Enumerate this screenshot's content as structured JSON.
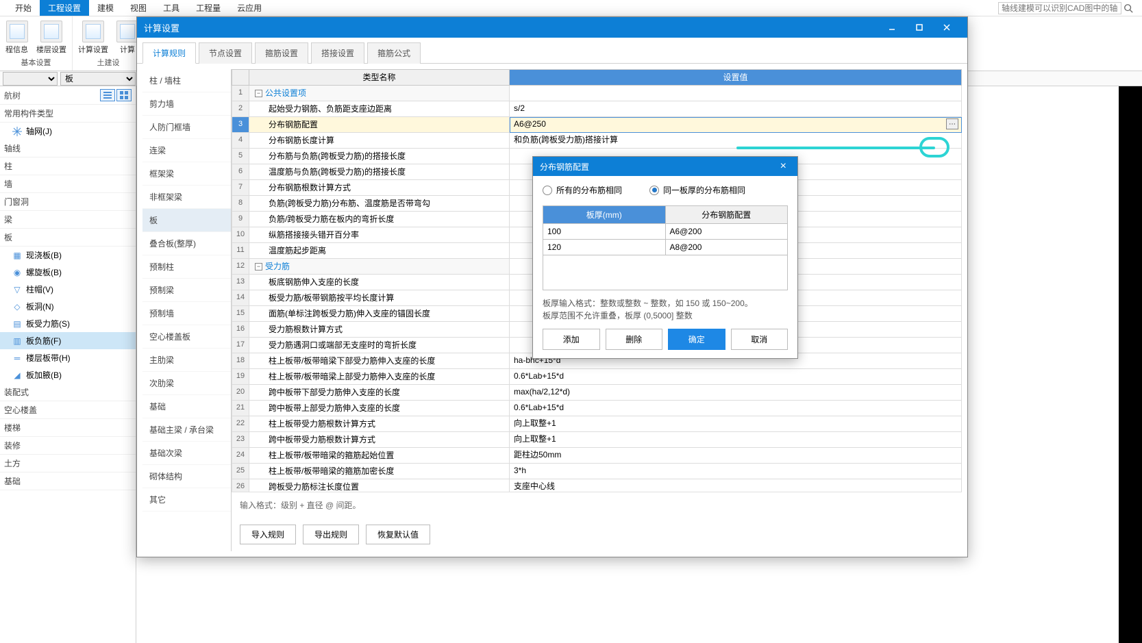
{
  "menubar": [
    "开始",
    "工程设置",
    "建模",
    "视图",
    "工具",
    "工程量",
    "云应用"
  ],
  "menubar_active": 1,
  "search_placeholder": "轴线建模可以识别CAD图中的轴线和承台吗？",
  "ribbon": {
    "groups": [
      {
        "title": "基本设置",
        "buttons": [
          "程信息",
          "楼层设置"
        ]
      },
      {
        "title": "土建设",
        "buttons": [
          "计算设置",
          "计算"
        ]
      }
    ]
  },
  "row2_select": "板",
  "left": {
    "nav_title": "航树",
    "section_common": "常用构件类型",
    "items_common": [
      "轴网(J)"
    ],
    "cats": [
      "轴线",
      "柱",
      "墙",
      "门窗洞",
      "梁",
      "板"
    ],
    "board_items": [
      "现浇板(B)",
      "螺旋板(B)",
      "柱帽(V)",
      "板洞(N)",
      "板受力筋(S)",
      "板负筋(F)",
      "楼层板带(H)",
      "板加腋(B)"
    ],
    "board_selected": 5,
    "below": [
      "装配式",
      "空心楼盖",
      "楼梯",
      "装修",
      "土方",
      "基础"
    ]
  },
  "dialog": {
    "title": "计算设置",
    "tabs": [
      "计算规则",
      "节点设置",
      "箍筋设置",
      "搭接设置",
      "箍筋公式"
    ],
    "tab_active": 0,
    "cats": [
      "柱 / 墙柱",
      "剪力墙",
      "人防门框墙",
      "连梁",
      "框架梁",
      "非框架梁",
      "板",
      "叠合板(整厚)",
      "预制柱",
      "预制梁",
      "预制墙",
      "空心楼盖板",
      "主肋梁",
      "次肋梁",
      "基础",
      "基础主梁 / 承台梁",
      "基础次梁",
      "砌体结构",
      "其它"
    ],
    "cat_selected": 6,
    "col_type": "类型名称",
    "col_val": "设置值",
    "rows": [
      {
        "n": 1,
        "t": "公共设置项",
        "v": "",
        "section": true
      },
      {
        "n": 2,
        "t": "起始受力钢筋、负筋距支座边距离",
        "v": "s/2"
      },
      {
        "n": 3,
        "t": "分布钢筋配置",
        "v": "A6@250",
        "active": true
      },
      {
        "n": 4,
        "t": "分布钢筋长度计算",
        "v": "和负筋(跨板受力筋)搭接计算"
      },
      {
        "n": 5,
        "t": "分布筋与负筋(跨板受力筋)的搭接长度",
        "v": ""
      },
      {
        "n": 6,
        "t": "温度筋与负筋(跨板受力筋)的搭接长度",
        "v": ""
      },
      {
        "n": 7,
        "t": "分布钢筋根数计算方式",
        "v": ""
      },
      {
        "n": 8,
        "t": "负筋(跨板受力筋)分布筋、温度筋是否带弯勾",
        "v": ""
      },
      {
        "n": 9,
        "t": "负筋/跨板受力筋在板内的弯折长度",
        "v": ""
      },
      {
        "n": 10,
        "t": "纵筋搭接接头错开百分率",
        "v": ""
      },
      {
        "n": 11,
        "t": "温度筋起步距离",
        "v": ""
      },
      {
        "n": 12,
        "t": "受力筋",
        "v": "",
        "section": true
      },
      {
        "n": 13,
        "t": "板底钢筋伸入支座的长度",
        "v": ""
      },
      {
        "n": 14,
        "t": "板受力筋/板带钢筋按平均长度计算",
        "v": ""
      },
      {
        "n": 15,
        "t": "面筋(单标注跨板受力筋)伸入支座的锚固长度",
        "v": ""
      },
      {
        "n": 16,
        "t": "受力筋根数计算方式",
        "v": ""
      },
      {
        "n": 17,
        "t": "受力筋遇洞口或端部无支座时的弯折长度",
        "v": ""
      },
      {
        "n": 18,
        "t": "柱上板带/板带暗梁下部受力筋伸入支座的长度",
        "v": "ha-bhc+15*d"
      },
      {
        "n": 19,
        "t": "柱上板带/板带暗梁上部受力筋伸入支座的长度",
        "v": "0.6*Lab+15*d"
      },
      {
        "n": 20,
        "t": "跨中板带下部受力筋伸入支座的长度",
        "v": "max(ha/2,12*d)"
      },
      {
        "n": 21,
        "t": "跨中板带上部受力筋伸入支座的长度",
        "v": "0.6*Lab+15*d"
      },
      {
        "n": 22,
        "t": "柱上板带受力筋根数计算方式",
        "v": "向上取整+1"
      },
      {
        "n": 23,
        "t": "跨中板带受力筋根数计算方式",
        "v": "向上取整+1"
      },
      {
        "n": 24,
        "t": "柱上板带/板带暗梁的箍筋起始位置",
        "v": "距柱边50mm"
      },
      {
        "n": 25,
        "t": "柱上板带/板带暗梁的箍筋加密长度",
        "v": "3*h"
      },
      {
        "n": 26,
        "t": "跨板受力筋标注长度位置",
        "v": "支座中心线"
      }
    ],
    "input_hint": "输入格式：级别 + 直径 @ 间距。",
    "footer_btns": [
      "导入规则",
      "导出规则",
      "恢复默认值"
    ]
  },
  "popup": {
    "title": "分布钢筋配置",
    "radio1": "所有的分布筋相同",
    "radio2": "同一板厚的分布筋相同",
    "col1": "板厚(mm)",
    "col2": "分布钢筋配置",
    "rows": [
      {
        "a": "100",
        "b": "A6@200"
      },
      {
        "a": "120",
        "b": "A8@200"
      }
    ],
    "hint1": "板厚输入格式：整数或整数 ~ 整数，如 150 或 150~200。",
    "hint2": "板厚范围不允许重叠，板厚 (0,5000] 整数",
    "btns": [
      "添加",
      "删除",
      "确定",
      "取消"
    ]
  }
}
